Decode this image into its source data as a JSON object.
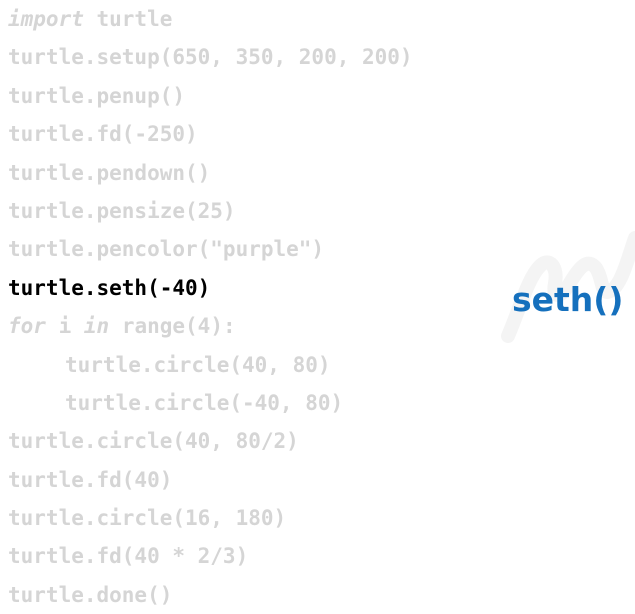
{
  "code": {
    "lines": [
      {
        "kw": "import",
        "rest": " turtle"
      },
      {
        "text": "turtle.setup(650, 350, 200, 200)"
      },
      {
        "text": "turtle.penup()"
      },
      {
        "text": "turtle.fd(-250)"
      },
      {
        "text": "turtle.pendown()"
      },
      {
        "text": "turtle.pensize(25)"
      },
      {
        "text": "turtle.pencolor(\"purple\")"
      },
      {
        "text": "turtle.seth(-40)"
      },
      {
        "kw": "for",
        "mid": " i ",
        "kw2": "in",
        "rest": " range(4):"
      },
      {
        "text": "turtle.circle(40, 80)"
      },
      {
        "text": "turtle.circle(-40, 80)"
      },
      {
        "text": "turtle.circle(40, 80/2)"
      },
      {
        "text": "turtle.fd(40)"
      },
      {
        "text": "turtle.circle(16, 180)"
      },
      {
        "text": "turtle.fd(40 * 2/3)"
      },
      {
        "text": "turtle.done()"
      }
    ],
    "highlighted_line": "turtle.seth(-40)"
  },
  "side_label": "seth()",
  "colors": {
    "dimmed_code": "#d5d5d5",
    "highlighted_code": "#000000",
    "accent": "#1570bd",
    "watermark": "#f4f4f4"
  }
}
